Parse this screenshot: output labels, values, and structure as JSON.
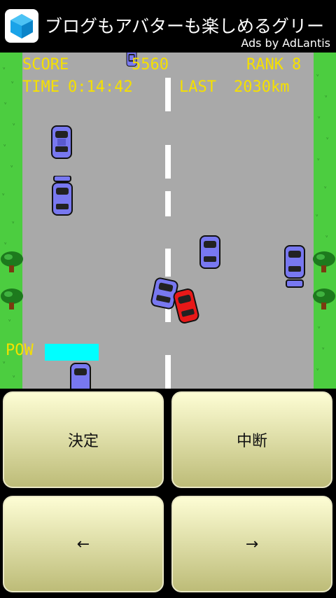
{
  "ad": {
    "text": "ブログもアバターも楽しめるグリー",
    "credit": "Ads by AdLantis",
    "icon": "hexagon-cube-icon"
  },
  "hud": {
    "score_label": "SCORE",
    "score_value": "5560",
    "rank_label": "RANK",
    "rank_value": "8",
    "time_label": "TIME",
    "time_value": "0:14:42",
    "last_label": "LAST",
    "last_value": "2030km",
    "pow_label": "POW",
    "pow_level": 1.0
  },
  "colors": {
    "grass": "#4ccd40",
    "road": "#a9a9a9",
    "hud_text": "#f5e000",
    "pow_bar": "#00ffff",
    "player_car": "#e81818",
    "enemy_car": "#7878f0"
  },
  "controls": {
    "confirm": "決定",
    "pause": "中断",
    "left": "←",
    "right": "→"
  }
}
